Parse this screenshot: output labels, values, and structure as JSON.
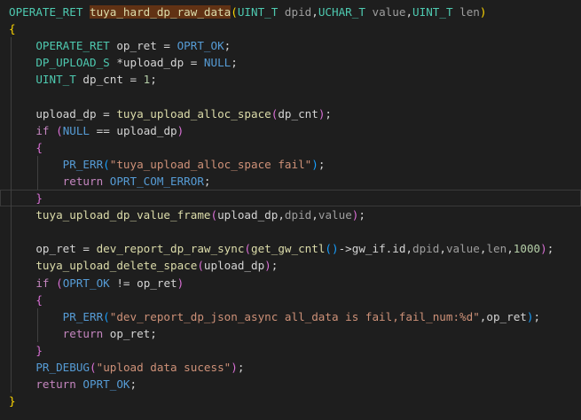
{
  "editor": {
    "lines": [
      [
        {
          "t": "OPERATE_RET ",
          "c": "type"
        },
        {
          "t": "tuya_hard_dp_raw_data",
          "c": "fn-hl"
        },
        {
          "t": "(",
          "c": "brace"
        },
        {
          "t": "UINT_T ",
          "c": "type"
        },
        {
          "t": "dpid",
          "c": "dim"
        },
        {
          "t": ",",
          "c": "plain"
        },
        {
          "t": "UCHAR_T ",
          "c": "type"
        },
        {
          "t": "value",
          "c": "dim"
        },
        {
          "t": ",",
          "c": "plain"
        },
        {
          "t": "UINT_T ",
          "c": "type"
        },
        {
          "t": "len",
          "c": "dim"
        },
        {
          "t": ")",
          "c": "brace"
        }
      ],
      [
        {
          "t": "{",
          "c": "brace"
        }
      ],
      [
        {
          "t": "    ",
          "c": "plain"
        },
        {
          "t": "OPERATE_RET ",
          "c": "type"
        },
        {
          "t": "op_ret",
          "c": "plain"
        },
        {
          "t": " = ",
          "c": "plain"
        },
        {
          "t": "OPRT_OK",
          "c": "macro"
        },
        {
          "t": ";",
          "c": "plain"
        }
      ],
      [
        {
          "t": "    ",
          "c": "plain"
        },
        {
          "t": "DP_UPLOAD_S ",
          "c": "type"
        },
        {
          "t": "*upload_dp",
          "c": "plain"
        },
        {
          "t": " = ",
          "c": "plain"
        },
        {
          "t": "NULL",
          "c": "macro"
        },
        {
          "t": ";",
          "c": "plain"
        }
      ],
      [
        {
          "t": "    ",
          "c": "plain"
        },
        {
          "t": "UINT_T ",
          "c": "type"
        },
        {
          "t": "dp_cnt",
          "c": "plain"
        },
        {
          "t": " = ",
          "c": "plain"
        },
        {
          "t": "1",
          "c": "num"
        },
        {
          "t": ";",
          "c": "plain"
        }
      ],
      [
        {
          "t": "",
          "c": "plain"
        }
      ],
      [
        {
          "t": "    ",
          "c": "plain"
        },
        {
          "t": "upload_dp",
          "c": "plain"
        },
        {
          "t": " = ",
          "c": "plain"
        },
        {
          "t": "tuya_upload_alloc_space",
          "c": "fn"
        },
        {
          "t": "(",
          "c": "paren"
        },
        {
          "t": "dp_cnt",
          "c": "plain"
        },
        {
          "t": ")",
          "c": "paren"
        },
        {
          "t": ";",
          "c": "plain"
        }
      ],
      [
        {
          "t": "    ",
          "c": "plain"
        },
        {
          "t": "if",
          "c": "kw2"
        },
        {
          "t": " (",
          "c": "paren"
        },
        {
          "t": "NULL",
          "c": "macro"
        },
        {
          "t": " == ",
          "c": "plain"
        },
        {
          "t": "upload_dp",
          "c": "plain"
        },
        {
          "t": ")",
          "c": "paren"
        }
      ],
      [
        {
          "t": "    ",
          "c": "plain"
        },
        {
          "t": "{",
          "c": "paren"
        }
      ],
      [
        {
          "t": "        ",
          "c": "plain"
        },
        {
          "t": "PR_ERR",
          "c": "macro"
        },
        {
          "t": "(",
          "c": "bracket2"
        },
        {
          "t": "\"tuya_upload_alloc_space fail\"",
          "c": "str"
        },
        {
          "t": ")",
          "c": "bracket2"
        },
        {
          "t": ";",
          "c": "plain"
        }
      ],
      [
        {
          "t": "        ",
          "c": "plain"
        },
        {
          "t": "return ",
          "c": "kw2"
        },
        {
          "t": "OPRT_COM_ERROR",
          "c": "macro"
        },
        {
          "t": ";",
          "c": "plain"
        }
      ],
      [
        {
          "t": "    ",
          "c": "plain"
        },
        {
          "t": "}",
          "c": "paren"
        }
      ],
      [
        {
          "t": "    ",
          "c": "plain"
        },
        {
          "t": "tuya_upload_dp_value_frame",
          "c": "fn"
        },
        {
          "t": "(",
          "c": "paren"
        },
        {
          "t": "upload_dp",
          "c": "plain"
        },
        {
          "t": ",",
          "c": "plain"
        },
        {
          "t": "dpid",
          "c": "dim"
        },
        {
          "t": ",",
          "c": "plain"
        },
        {
          "t": "value",
          "c": "dim"
        },
        {
          "t": ")",
          "c": "paren"
        },
        {
          "t": ";",
          "c": "plain"
        }
      ],
      [
        {
          "t": "",
          "c": "plain"
        }
      ],
      [
        {
          "t": "    ",
          "c": "plain"
        },
        {
          "t": "op_ret",
          "c": "plain"
        },
        {
          "t": " = ",
          "c": "plain"
        },
        {
          "t": "dev_report_dp_raw_sync",
          "c": "fn"
        },
        {
          "t": "(",
          "c": "paren"
        },
        {
          "t": "get_gw_cntl",
          "c": "fn"
        },
        {
          "t": "()",
          "c": "bracket2"
        },
        {
          "t": "->gw_if.id",
          "c": "plain"
        },
        {
          "t": ",",
          "c": "plain"
        },
        {
          "t": "dpid",
          "c": "dim"
        },
        {
          "t": ",",
          "c": "plain"
        },
        {
          "t": "value",
          "c": "dim"
        },
        {
          "t": ",",
          "c": "plain"
        },
        {
          "t": "len",
          "c": "dim"
        },
        {
          "t": ",",
          "c": "plain"
        },
        {
          "t": "1000",
          "c": "num"
        },
        {
          "t": ")",
          "c": "paren"
        },
        {
          "t": ";",
          "c": "plain"
        }
      ],
      [
        {
          "t": "    ",
          "c": "plain"
        },
        {
          "t": "tuya_upload_delete_space",
          "c": "fn"
        },
        {
          "t": "(",
          "c": "paren"
        },
        {
          "t": "upload_dp",
          "c": "plain"
        },
        {
          "t": ")",
          "c": "paren"
        },
        {
          "t": ";",
          "c": "plain"
        }
      ],
      [
        {
          "t": "    ",
          "c": "plain"
        },
        {
          "t": "if",
          "c": "kw2"
        },
        {
          "t": " (",
          "c": "paren"
        },
        {
          "t": "OPRT_OK",
          "c": "macro"
        },
        {
          "t": " != ",
          "c": "plain"
        },
        {
          "t": "op_ret",
          "c": "plain"
        },
        {
          "t": ")",
          "c": "paren"
        }
      ],
      [
        {
          "t": "    ",
          "c": "plain"
        },
        {
          "t": "{",
          "c": "paren"
        }
      ],
      [
        {
          "t": "        ",
          "c": "plain"
        },
        {
          "t": "PR_ERR",
          "c": "macro"
        },
        {
          "t": "(",
          "c": "bracket2"
        },
        {
          "t": "\"dev_report_dp_json_async all_data is fail,fail_num:%d\"",
          "c": "str"
        },
        {
          "t": ",",
          "c": "plain"
        },
        {
          "t": "op_ret",
          "c": "plain"
        },
        {
          "t": ")",
          "c": "bracket2"
        },
        {
          "t": ";",
          "c": "plain"
        }
      ],
      [
        {
          "t": "        ",
          "c": "plain"
        },
        {
          "t": "return ",
          "c": "kw2"
        },
        {
          "t": "op_ret",
          "c": "plain"
        },
        {
          "t": ";",
          "c": "plain"
        }
      ],
      [
        {
          "t": "    ",
          "c": "plain"
        },
        {
          "t": "}",
          "c": "paren"
        }
      ],
      [
        {
          "t": "    ",
          "c": "plain"
        },
        {
          "t": "PR_DEBUG",
          "c": "macro"
        },
        {
          "t": "(",
          "c": "paren"
        },
        {
          "t": "\"upload data sucess\"",
          "c": "str"
        },
        {
          "t": ")",
          "c": "paren"
        },
        {
          "t": ";",
          "c": "plain"
        }
      ],
      [
        {
          "t": "    ",
          "c": "plain"
        },
        {
          "t": "return ",
          "c": "kw2"
        },
        {
          "t": "OPRT_OK",
          "c": "macro"
        },
        {
          "t": ";",
          "c": "plain"
        }
      ],
      [
        {
          "t": "}",
          "c": "brace"
        }
      ]
    ]
  }
}
